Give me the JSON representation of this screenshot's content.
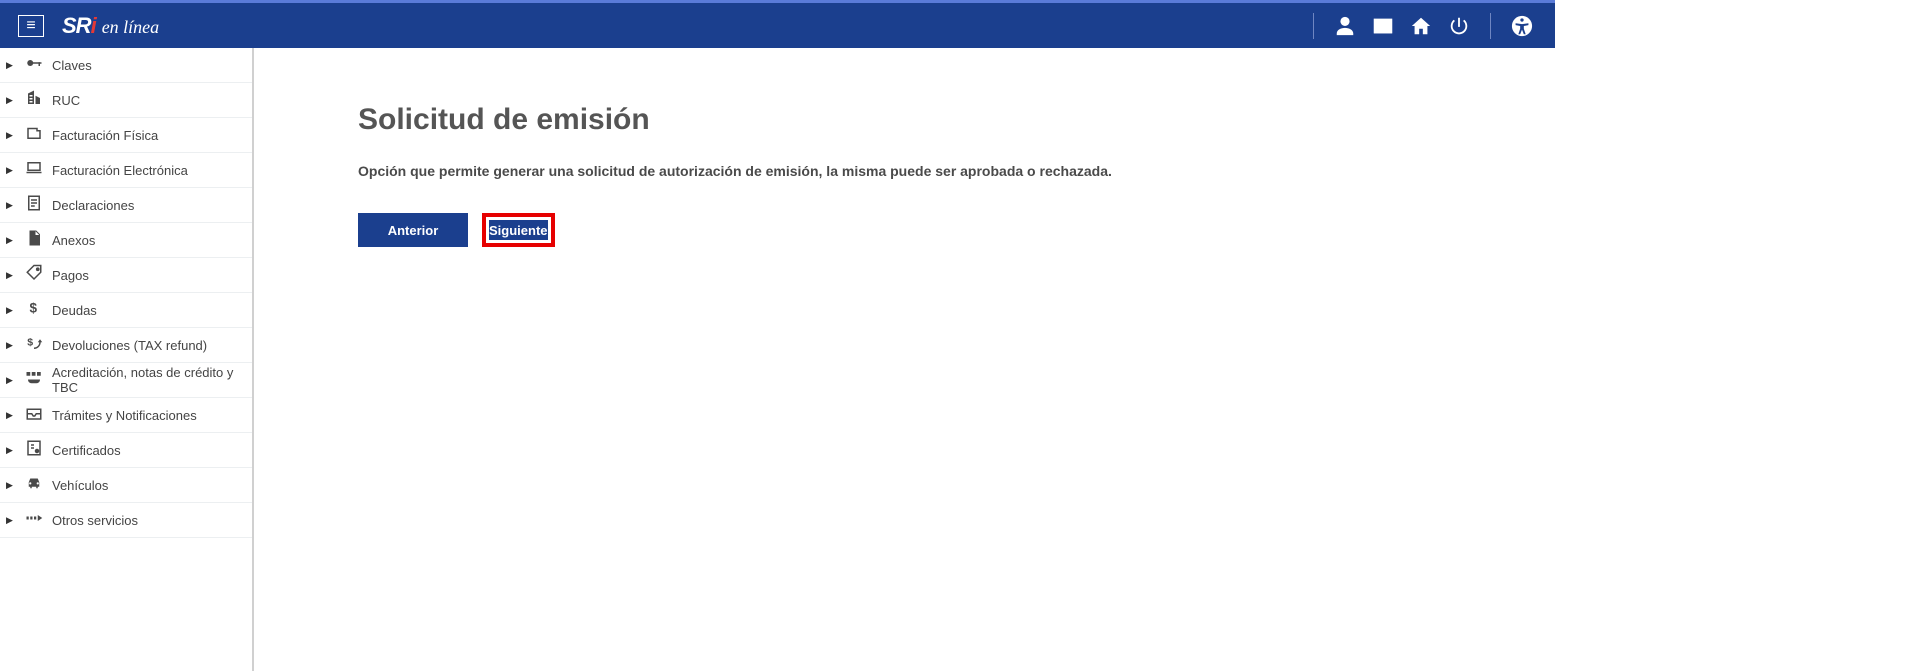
{
  "brand": {
    "name_part1": "SR",
    "name_part2": "i",
    "subtitle": "en línea"
  },
  "sidebar": {
    "items": [
      {
        "label": "Claves",
        "icon": "key-icon"
      },
      {
        "label": "RUC",
        "icon": "building-icon"
      },
      {
        "label": "Facturación Física",
        "icon": "receipt-icon"
      },
      {
        "label": "Facturación Electrónica",
        "icon": "laptop-icon"
      },
      {
        "label": "Declaraciones",
        "icon": "form-icon"
      },
      {
        "label": "Anexos",
        "icon": "document-icon"
      },
      {
        "label": "Pagos",
        "icon": "tag-icon"
      },
      {
        "label": "Deudas",
        "icon": "dollar-icon"
      },
      {
        "label": "Devoluciones (TAX refund)",
        "icon": "dollar-refund-icon"
      },
      {
        "label": "Acreditación, notas de crédito y TBC",
        "icon": "credit-note-icon"
      },
      {
        "label": "Trámites y Notificaciones",
        "icon": "inbox-icon"
      },
      {
        "label": "Certificados",
        "icon": "certificate-icon"
      },
      {
        "label": "Vehículos",
        "icon": "car-icon"
      },
      {
        "label": "Otros servicios",
        "icon": "more-icon"
      }
    ]
  },
  "main": {
    "title": "Solicitud de emisión",
    "description": "Opción que permite generar una solicitud de autorización de emisión, la misma puede ser aprobada o rechazada.",
    "prev_label": "Anterior",
    "next_label": "Siguiente"
  },
  "colors": {
    "primary": "#1b3f8e",
    "highlight": "#e60000"
  }
}
